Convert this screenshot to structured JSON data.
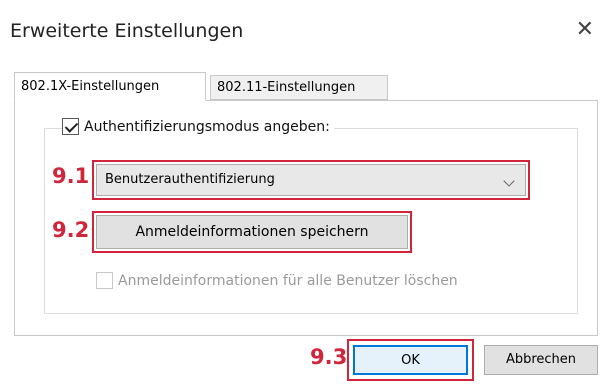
{
  "dialog": {
    "title": "Erweiterte Einstellungen",
    "close_glyph": "✕"
  },
  "tabs": [
    {
      "label": "802.1X-Einstellungen",
      "active": true
    },
    {
      "label": "802.11-Einstellungen",
      "active": false
    }
  ],
  "auth_mode": {
    "checkbox_label": "Authentifizierungsmodus angeben:",
    "checked": true,
    "selected_value": "Benutzerauthentifizierung"
  },
  "save_credentials_label": "Anmeldeinformationen speichern",
  "delete_all_users": {
    "label": "Anmeldeinformationen für alle Benutzer löschen",
    "checked": false,
    "enabled": false
  },
  "buttons": {
    "ok": "OK",
    "cancel": "Abbrechen"
  },
  "annotations": {
    "m1": "9.1",
    "m2": "9.2",
    "m3": "9.3",
    "color": "#d0253a"
  },
  "icons": {
    "close": "close-icon",
    "dropdown": "chevron-down-icon",
    "check": "checkmark-icon"
  }
}
